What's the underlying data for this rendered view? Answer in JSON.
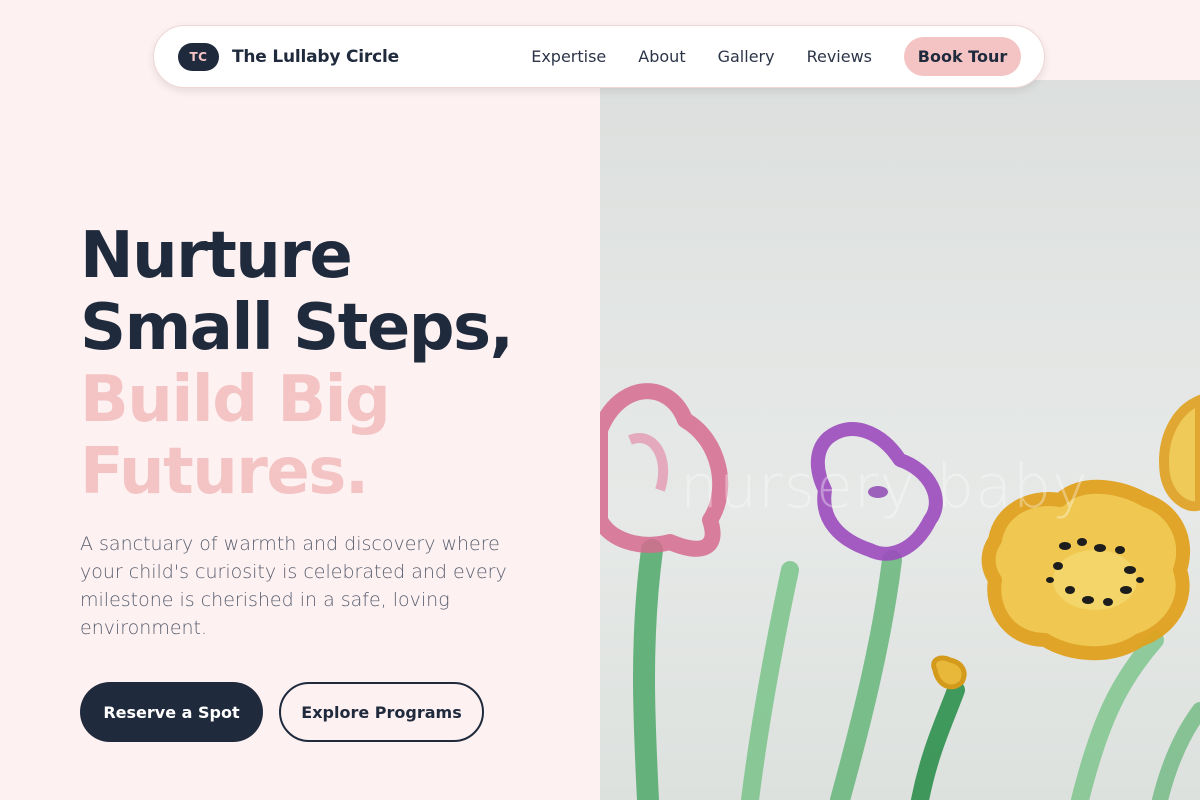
{
  "nav": {
    "logo_initials": "TC",
    "brand": "The Lullaby Circle",
    "links": [
      "Expertise",
      "About",
      "Gallery",
      "Reviews"
    ],
    "cta": "Book Tour"
  },
  "hero": {
    "headline_line1": "Nurture",
    "headline_line2": "Small Steps,",
    "headline_line3": "Build Big",
    "headline_line4": "Futures.",
    "description": "A sanctuary of warmth and discovery where your child's curiosity is celebrated and every milestone is cherished in a safe, loving environment.",
    "primary_button": "Reserve a Spot",
    "secondary_button": "Explore Programs",
    "image_watermark": "nursery baby"
  },
  "colors": {
    "navy": "#1f2a3d",
    "pink_accent": "#f4c4c4",
    "page_background": "#fdf1f1"
  }
}
